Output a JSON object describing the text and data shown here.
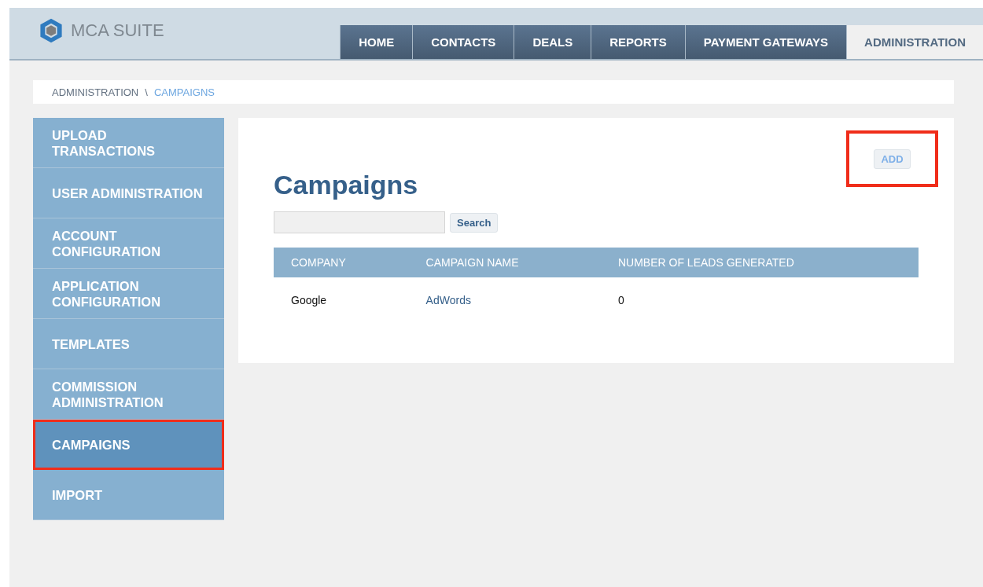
{
  "logo": {
    "text": "MCA SUITE"
  },
  "tabs": [
    {
      "label": "HOME",
      "selected": false
    },
    {
      "label": "CONTACTS",
      "selected": false
    },
    {
      "label": "DEALS",
      "selected": false
    },
    {
      "label": "REPORTS",
      "selected": false
    },
    {
      "label": "PAYMENT GATEWAYS",
      "selected": false
    },
    {
      "label": "ADMINISTRATION",
      "selected": true
    }
  ],
  "breadcrumb": [
    {
      "label": "ADMINISTRATION",
      "current": false
    },
    {
      "label": "CAMPAIGNS",
      "current": true
    }
  ],
  "breadcrumb_separator": "\\",
  "sidebar": {
    "items": [
      {
        "label": "UPLOAD TRANSACTIONS",
        "selected": false,
        "highlighted": false
      },
      {
        "label": "USER ADMINISTRATION",
        "selected": false,
        "highlighted": false
      },
      {
        "label": "ACCOUNT CONFIGURATION",
        "selected": false,
        "highlighted": false
      },
      {
        "label": "APPLICATION CONFIGURATION",
        "selected": false,
        "highlighted": false
      },
      {
        "label": "TEMPLATES",
        "selected": false,
        "highlighted": false
      },
      {
        "label": "COMMISSION ADMINISTRATION",
        "selected": false,
        "highlighted": false
      },
      {
        "label": "CAMPAIGNS",
        "selected": true,
        "highlighted": true
      },
      {
        "label": "IMPORT",
        "selected": false,
        "highlighted": false
      }
    ]
  },
  "content": {
    "title": "Campaigns",
    "add_button": {
      "label": "ADD",
      "highlighted": true
    },
    "search": {
      "button": "Search"
    },
    "table": {
      "columns": [
        "COMPANY",
        "CAMPAIGN NAME",
        "NUMBER OF LEADS GENERATED"
      ],
      "rows": [
        [
          "Google",
          "AdWords",
          "0"
        ]
      ]
    }
  }
}
